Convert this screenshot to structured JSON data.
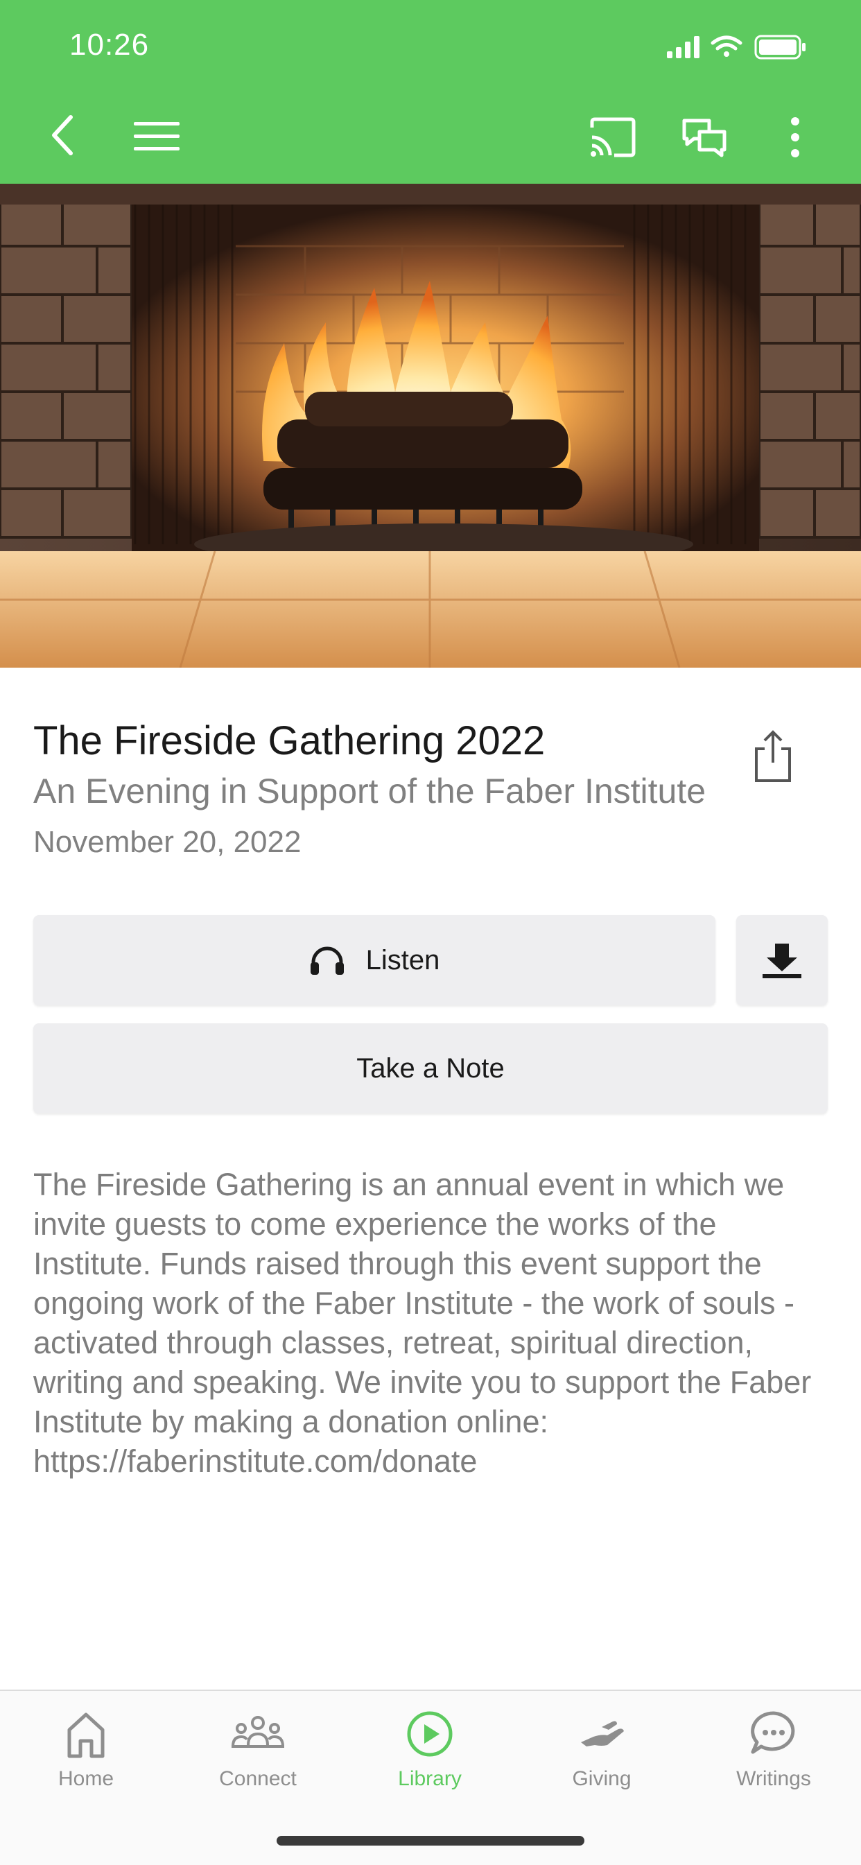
{
  "status_bar": {
    "time": "10:26"
  },
  "header": {
    "back_icon": "chevron-left-icon",
    "menu_icon": "hamburger-menu-icon",
    "cast_icon": "cast-icon",
    "chat_icon": "chat-bubbles-icon",
    "more_icon": "more-vertical-icon"
  },
  "media": {
    "title": "The Fireside Gathering 2022",
    "subtitle": "An Evening in Support of the Faber Institute",
    "date": "November 20, 2022"
  },
  "actions": {
    "listen_label": "Listen",
    "take_note_label": "Take a Note"
  },
  "description": "The Fireside Gathering is an annual event in which we invite guests to come experience the works of the Institute. Funds raised through this event support the ongoing work of the Faber Institute - the work of souls - activated through classes, retreat, spiritual direction, writing and speaking. We invite you to support the Faber Institute by making a donation online: https://faberinstitute.com/donate",
  "tabs": [
    {
      "label": "Home",
      "icon": "home-icon"
    },
    {
      "label": "Connect",
      "icon": "group-icon"
    },
    {
      "label": "Library",
      "icon": "play-circle-icon",
      "active": true
    },
    {
      "label": "Giving",
      "icon": "giving-hand-icon"
    },
    {
      "label": "Writings",
      "icon": "chat-bubble-icon"
    }
  ],
  "colors": {
    "accent": "#5dca5f",
    "button_bg": "#eeeef0",
    "muted_text": "#808080"
  }
}
